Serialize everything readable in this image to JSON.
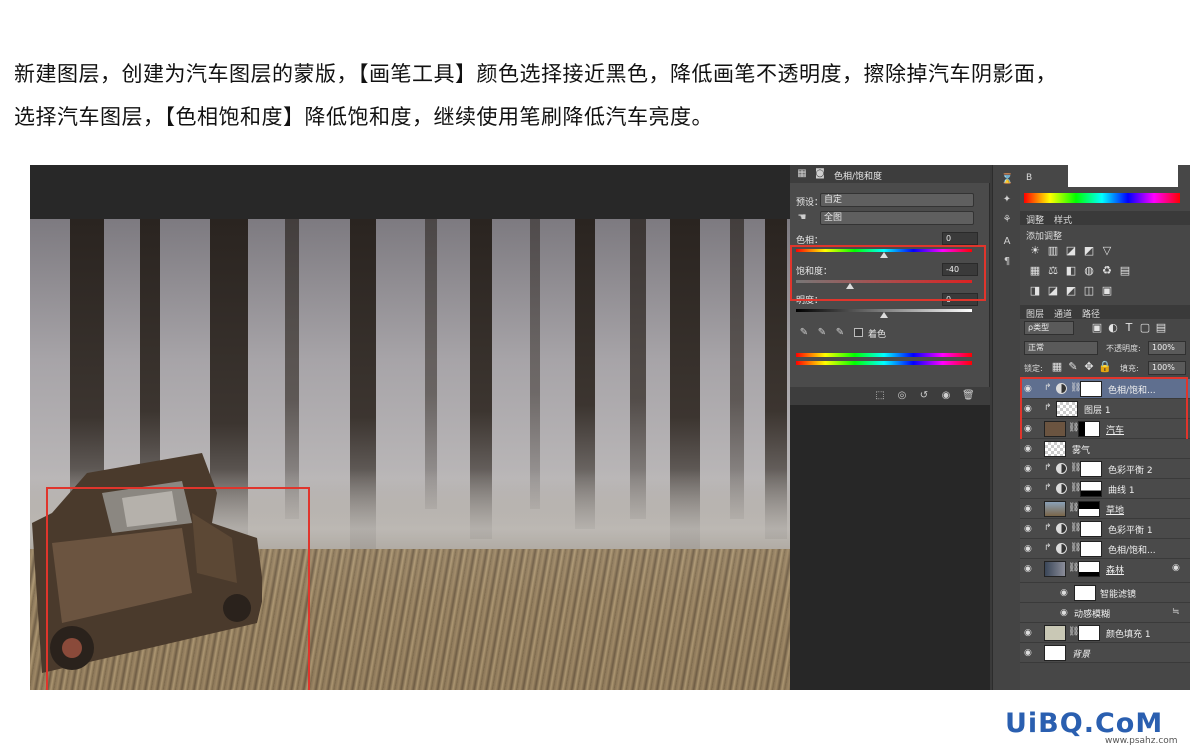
{
  "instructions": {
    "line1": "新建图层，创建为汽车图层的蒙版，【画笔工具】颜色选择接近黑色，降低画笔不透明度，擦除掉汽车阴影面，",
    "line2": "选择汽车图层，【色相饱和度】降低饱和度，继续使用笔刷降低汽车亮度。"
  },
  "properties_panel": {
    "title": "色相/饱和度",
    "preset_label": "预设：",
    "preset_value": "自定",
    "channel_value": "全图",
    "hue_label": "色相：",
    "hue_value": "0",
    "saturation_label": "饱和度：",
    "saturation_value": "-40",
    "lightness_label": "明度：",
    "lightness_value": "0",
    "colorize_label": "着色"
  },
  "right_panel": {
    "color_channel_label": "B",
    "tab_adjustments": "调整",
    "tab_styles": "样式",
    "add_adjustment_label": "添加调整",
    "tab_layers": "图层",
    "tab_channels": "通道",
    "tab_paths": "路径",
    "filter_kind": "ρ类型",
    "blend_mode": "正常",
    "opacity_label": "不透明度:",
    "opacity_value": "100%",
    "lock_label": "锁定:",
    "fill_label": "填充:",
    "fill_value": "100%"
  },
  "layers": [
    {
      "name": "色相/饱和...",
      "type": "adjustment",
      "clipped": true,
      "selected": true
    },
    {
      "name": "图层 1",
      "type": "pixel",
      "clipped": true,
      "selected": false
    },
    {
      "name": "汽车",
      "type": "pixel-mask",
      "clipped": false,
      "selected": false
    },
    {
      "name": "雾气",
      "type": "pixel",
      "clipped": false,
      "selected": false
    },
    {
      "name": "色彩平衡 2",
      "type": "adjustment",
      "clipped": true,
      "selected": false
    },
    {
      "name": "曲线 1",
      "type": "adjustment",
      "clipped": true,
      "selected": false
    },
    {
      "name": "草地",
      "type": "pixel-mask",
      "clipped": false,
      "selected": false
    },
    {
      "name": "色彩平衡 1",
      "type": "adjustment",
      "clipped": true,
      "selected": false
    },
    {
      "name": "色相/饱和...",
      "type": "adjustment",
      "clipped": true,
      "selected": false
    },
    {
      "name": "森林",
      "type": "smart-object",
      "clipped": false,
      "selected": false
    },
    {
      "name": "智能滤镜",
      "type": "smart-filter",
      "clipped": false,
      "selected": false
    },
    {
      "name": "动感模糊",
      "type": "filter",
      "clipped": false,
      "selected": false
    },
    {
      "name": "颜色填充 1",
      "type": "fill",
      "clipped": false,
      "selected": false
    },
    {
      "name": "背景",
      "type": "background",
      "clipped": false,
      "selected": false
    }
  ],
  "watermark": {
    "logo": "UiBQ.CoM",
    "url": "www.psahz.com"
  },
  "colors": {
    "highlight_box": "#e0352c",
    "panel_bg": "#474747",
    "selected_layer": "#5f6f8f"
  }
}
